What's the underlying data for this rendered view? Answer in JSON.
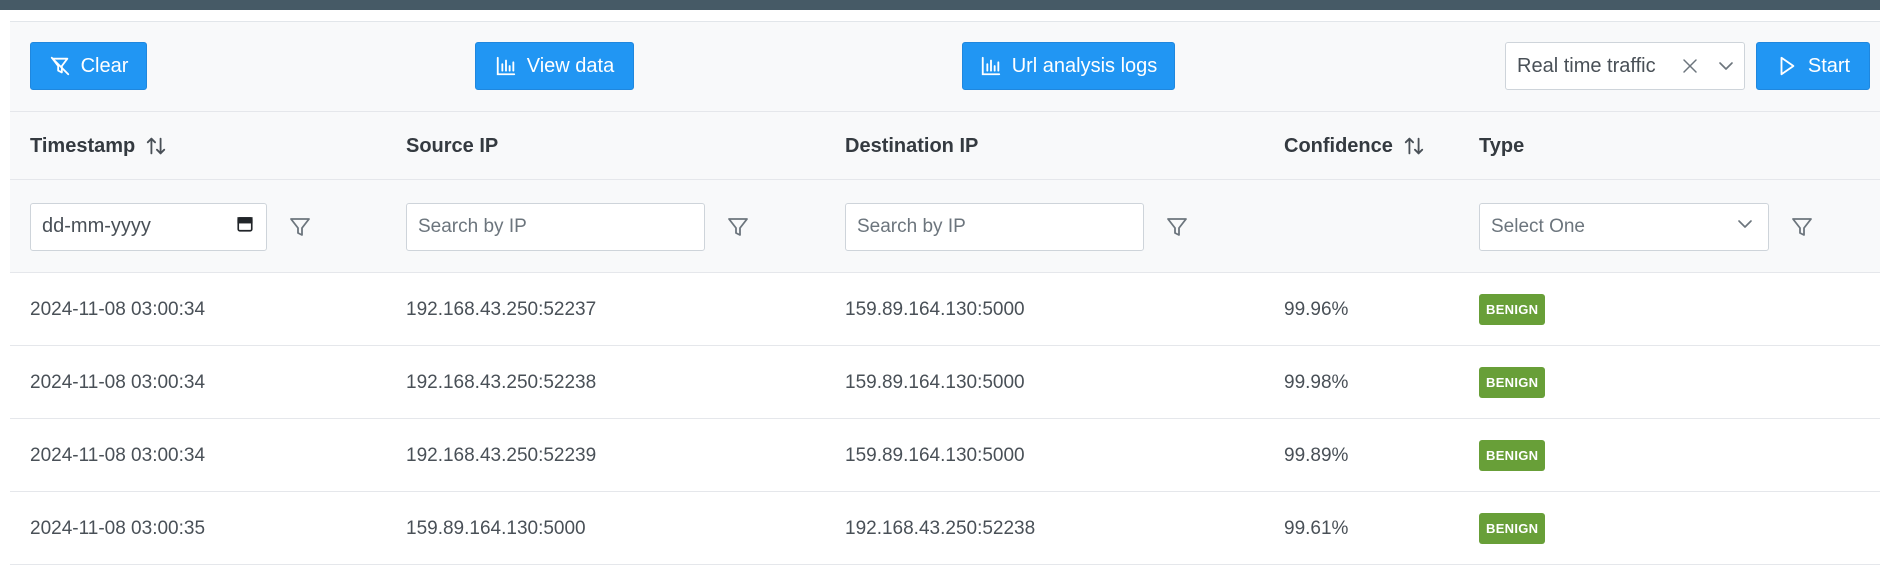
{
  "toolbar": {
    "clear_label": "Clear",
    "view_label": "View data",
    "url_label": "Url analysis logs",
    "traffic_select": "Real time traffic",
    "start_label": "Start"
  },
  "columns": {
    "timestamp": "Timestamp",
    "source_ip": "Source IP",
    "destination_ip": "Destination IP",
    "confidence": "Confidence",
    "type": "Type"
  },
  "filters": {
    "date_placeholder": "dd-mm-yyyy",
    "source_placeholder": "Search by IP",
    "destination_placeholder": "Search by IP",
    "type_placeholder": "Select One"
  },
  "rows": [
    {
      "timestamp": "2024-11-08 03:00:34",
      "source": "192.168.43.250:52237",
      "destination": "159.89.164.130:5000",
      "confidence": "99.96%",
      "type": "BENIGN"
    },
    {
      "timestamp": "2024-11-08 03:00:34",
      "source": "192.168.43.250:52238",
      "destination": "159.89.164.130:5000",
      "confidence": "99.98%",
      "type": "BENIGN"
    },
    {
      "timestamp": "2024-11-08 03:00:34",
      "source": "192.168.43.250:52239",
      "destination": "159.89.164.130:5000",
      "confidence": "99.89%",
      "type": "BENIGN"
    },
    {
      "timestamp": "2024-11-08 03:00:35",
      "source": "159.89.164.130:5000",
      "destination": "192.168.43.250:52238",
      "confidence": "99.61%",
      "type": "BENIGN"
    }
  ],
  "colors": {
    "primary": "#2196f3",
    "benign_badge": "#689f38",
    "topbar": "#465a66"
  },
  "icons": {
    "clear": "filter-slash-icon",
    "view": "chart-bar-icon",
    "url": "chart-bar-icon",
    "start": "play-icon",
    "sort": "sort-alt-icon",
    "filter": "filter-icon",
    "calendar": "calendar-icon",
    "clear_selection": "times-icon",
    "dropdown": "chevron-down-icon"
  }
}
